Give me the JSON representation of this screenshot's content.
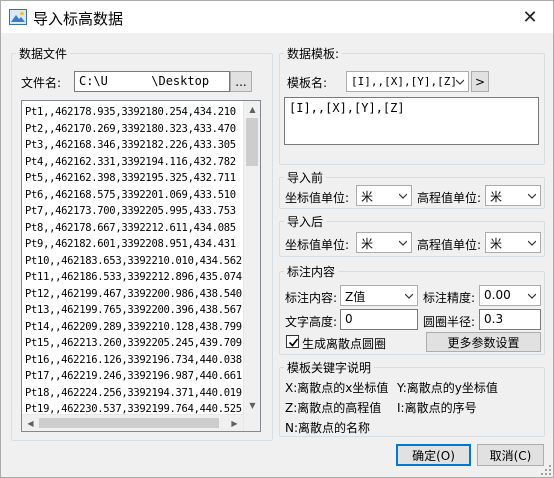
{
  "window": {
    "title": "导入标高数据",
    "close_glyph": "✕"
  },
  "data_file": {
    "group_label": "数据文件",
    "file_name_label": "文件名:",
    "file_path": "C:\\U      \\Desktop",
    "browse_label": "...",
    "rows": [
      "Pt1,,462178.935,3392180.254,434.210",
      "Pt2,,462170.269,3392180.323,433.470",
      "Pt3,,462168.346,3392182.226,433.305",
      "Pt4,,462162.331,3392194.116,432.782",
      "Pt5,,462162.398,3392195.325,432.711",
      "Pt6,,462168.575,3392201.069,433.510",
      "Pt7,,462173.700,3392205.995,433.753",
      "Pt8,,462178.667,3392212.611,434.085",
      "Pt9,,462182.601,3392208.951,434.431",
      "Pt10,,462183.653,3392210.010,434.562",
      "Pt11,,462186.533,3392212.896,435.074",
      "Pt12,,462199.467,3392200.986,438.540",
      "Pt13,,462199.765,3392200.396,438.567",
      "Pt14,,462209.289,3392210.128,438.799",
      "Pt15,,462213.260,3392205.245,439.709",
      "Pt16,,462216.126,3392196.734,440.038",
      "Pt17,,462219.246,3392196.987,440.661",
      "Pt18,,462224.256,3392194.371,440.019",
      "Pt19,,462230.537,3392199.764,440.525"
    ]
  },
  "template": {
    "group_label": "数据模板:",
    "name_label": "模板名:",
    "name_value": "[I],,[X],[Y],[Z]",
    "arrow_btn": ">",
    "content": "[I],,[X],[Y],[Z]"
  },
  "before_import": {
    "group_label": "导入前",
    "coord_unit_label": "坐标值单位:",
    "coord_unit_value": "米",
    "elev_unit_label": "高程值单位:",
    "elev_unit_value": "米"
  },
  "after_import": {
    "group_label": "导入后",
    "coord_unit_label": "坐标值单位:",
    "coord_unit_value": "米",
    "elev_unit_label": "高程值单位:",
    "elev_unit_value": "米"
  },
  "annotation": {
    "group_label": "标注内容",
    "content_label": "标注内容:",
    "content_value": "Z值",
    "precision_label": "标注精度:",
    "precision_value": "0.00",
    "text_height_label": "文字高度:",
    "text_height_value": "0",
    "circle_radius_label": "圆圈半径:",
    "circle_radius_value": "0.3",
    "gen_circle_label": "生成离散点圆圈",
    "gen_circle_checked": true,
    "more_params_label": "更多参数设置"
  },
  "keywords": {
    "group_label": "模板关键字说明",
    "x_desc": "X:离散点的x坐标值",
    "y_desc": "Y:离散点的y坐标值",
    "z_desc": "Z:离散点的高程值",
    "i_desc": "I:离散点的序号",
    "n_desc": "N:离散点的名称"
  },
  "footer": {
    "ok_label": "确定(O)",
    "cancel_label": "取消(C)"
  }
}
